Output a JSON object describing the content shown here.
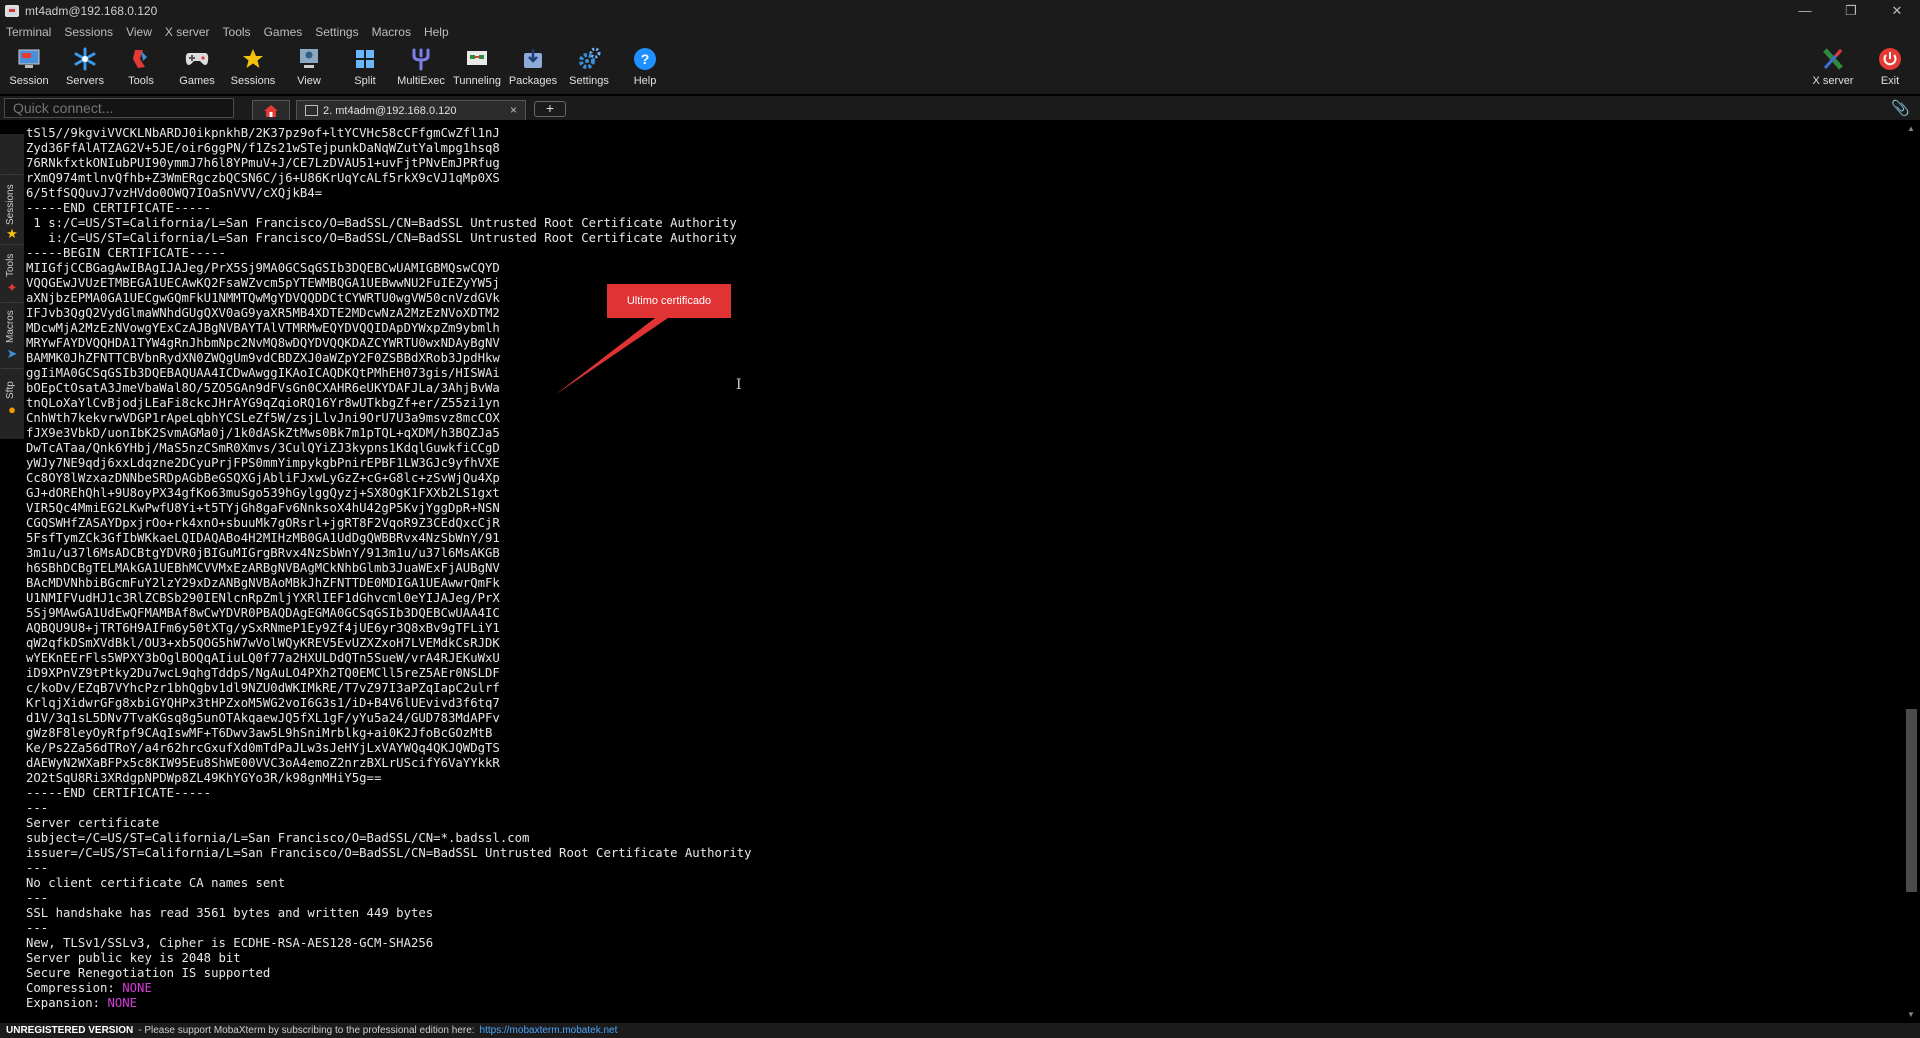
{
  "window": {
    "title": "mt4adm@192.168.0.120"
  },
  "menu": [
    "Terminal",
    "Sessions",
    "View",
    "X server",
    "Tools",
    "Games",
    "Settings",
    "Macros",
    "Help"
  ],
  "toolbar": {
    "session": "Session",
    "servers": "Servers",
    "tools": "Tools",
    "games": "Games",
    "sessions": "Sessions",
    "view": "View",
    "split": "Split",
    "multiexec": "MultiExec",
    "tunneling": "Tunneling",
    "packages": "Packages",
    "settings": "Settings",
    "help": "Help",
    "xserver": "X server",
    "exit": "Exit"
  },
  "tabs": {
    "quick_connect_placeholder": "Quick connect...",
    "session_tab_label": "2. mt4adm@192.168.0.120",
    "close": "×",
    "add": "+"
  },
  "sidebar": {
    "tabs": [
      "Sessions",
      "Tools",
      "Macros",
      "Sftp"
    ]
  },
  "terminal": {
    "lines": [
      "tSl5//9kgviVVCKLNbARDJ0ikpnkhB/2K37pz9of+ltYCVHc58cCFfgmCwZfl1nJ",
      "Zyd36FfAlATZAG2V+5JE/oir6ggPN/f1Zs21wSTejpunkDaNqWZutYalmpg1hsq8",
      "76RNkfxtkONIubPUI90ymmJ7h6l8YPmuV+J/CE7LzDVAU51+uvFjtPNvEmJPRfug",
      "rXmQ974mtlnvQfhb+Z3WmERgczbQCSN6C/j6+U86KrUqYcALf5rkX9cVJ1qMp0XS",
      "6/5tfSQQuvJ7vzHVdo0OWQ7IOaSnVVV/cXQjkB4=",
      "-----END CERTIFICATE-----",
      " 1 s:/C=US/ST=California/L=San Francisco/O=BadSSL/CN=BadSSL Untrusted Root Certificate Authority",
      "   i:/C=US/ST=California/L=San Francisco/O=BadSSL/CN=BadSSL Untrusted Root Certificate Authority",
      "-----BEGIN CERTIFICATE-----",
      "MIIGfjCCBGagAwIBAgIJAJeg/PrX5Sj9MA0GCSqGSIb3DQEBCwUAMIGBMQswCQYD",
      "VQQGEwJVUzETMBEGA1UECAwKQ2FsaWZvcm5pYTEWMBQGA1UEBwwNU2FuIEZyYW5j",
      "aXNjbzEPMA0GA1UECgwGQmFkU1NMMTQwMgYDVQQDDCtCYWRTU0wgVW50cnVzdGVk",
      "IFJvb3QgQ2VydGlmaWNhdGUgQXV0aG9yaXR5MB4XDTE2MDcwNzA2MzEzNVoXDTM2",
      "MDcwMjA2MzEzNVowgYExCzAJBgNVBAYTAlVTMRMwEQYDVQQIDApDYWxpZm9ybmlh",
      "MRYwFAYDVQQHDA1TYW4gRnJhbmNpc2NvMQ8wDQYDVQQKDAZCYWRTU0wxNDAyBgNV",
      "BAMMK0JhZFNTTCBVbnRydXN0ZWQgUm9vdCBDZXJ0aWZpY2F0ZSBBdXRob3JpdHkw",
      "ggIiMA0GCSqGSIb3DQEBAQUAA4ICDwAwggIKAoICAQDKQtPMhEH073gis/HISWAi",
      "bOEpCtOsatA3JmeVbaWal8O/5ZO5GAn9dFVsGn0CXAHR6eUKYDAFJLa/3AhjBvWa",
      "tnQLoXaYlCvBjodjLEaFi8ckcJHrAYG9qZqioRQ16Yr8wUTkbgZf+er/Z55zi1yn",
      "CnhWth7kekvrwVDGP1rApeLqbhYCSLeZf5W/zsjLlvJni9OrU7U3a9msvz8mcCOX",
      "fJX9e3VbkD/uonIbK2SvmAGMa0j/1k0dASkZtMws0Bk7m1pTQL+qXDM/h3BQZJa5",
      "DwTcATaa/Qnk6YHbj/MaS5nzCSmR0Xmvs/3CulQYiZJ3kypns1KdqlGuwkfiCCgD",
      "yWJy7NE9qdj6xxLdqzne2DCyuPrjFPS0mmYimpykgbPnirEPBF1LW3GJc9yfhVXE",
      "Cc8OY8lWzxazDNNbeSRDpAGbBeGSQXGjAbliFJxwLyGzZ+cG+G8lc+zSvWjQu4Xp",
      "GJ+dOREhQhl+9U8oyPX34gfKo63muSgo539hGylggQyzj+SX8OgK1FXXb2LS1gxt",
      "VIR5Qc4MmiEG2LKwPwfU8Yi+t5TYjGh8gaFv6NnksoX4hU42gP5KvjYggDpR+NSN",
      "CGQSWHfZASAYDpxjrOo+rk4xnO+sbuuMk7gORsrl+jgRT8F2VqoR9Z3CEdQxcCjR",
      "5FsfTymZCk3GfIbWKkaeLQIDAQABo4H2MIHzMB0GA1UdDgQWBBRvx4NzSbWnY/91",
      "3m1u/u37l6MsADCBtgYDVR0jBIGuMIGrgBRvx4NzSbWnY/913m1u/u37l6MsAKGB",
      "h6SBhDCBgTELMAkGA1UEBhMCVVMxEzARBgNVBAgMCkNhbGlmb3JuaWExFjAUBgNV",
      "BAcMDVNhbiBGcmFuY2lzY29xDzANBgNVBAoMBkJhZFNTTDE0MDIGA1UEAwwrQmFk",
      "U1NMIFVudHJ1c3RlZCBSb290IENlcnRpZmljYXRlIEF1dGhvcml0eYIJAJeg/PrX",
      "5Sj9MAwGA1UdEwQFMAMBAf8wCwYDVR0PBAQDAgEGMA0GCSqGSIb3DQEBCwUAA4IC",
      "AQBQU9U8+jTRT6H9AIFm6y50tXTg/ySxRNmeP1Ey9Zf4jUE6yr3Q8xBv9gTFLiY1",
      "qW2qfkDSmXVdBkl/OU3+xb5QOG5hW7wVolWQyKREV5EvUZXZxoH7LVEMdkCsRJDK",
      "wYEKnEErFls5WPXY3bOglBOQqAIiuLQ0f77a2HXULDdQTn5SueW/vrA4RJEKuWxU",
      "iD9XPnVZ9tPtky2Du7wcL9qhgTddpS/NgAuLO4PXh2TQ0EMCll5reZ5AEr0NSLDF",
      "c/koDv/EZqB7VYhcPzr1bhQgbv1dl9NZU0dWKIMkRE/T7vZ97I3aPZqIapC2ulrf",
      "KrlqjXidwrGFg8xbiGYQHPx3tHPZxoM5WG2voI6G3s1/iD+B4V6lUEvivd3f6tq7",
      "d1V/3q1sL5DNv7TvaKGsq8g5unOTAkqaewJQ5fXL1gF/yYu5a24/GUD783MdAPFv",
      "gWz8F8leyOyRfpf9CAqIswMF+T6Dwv3aw5L9hSniMrblkg+ai0K2JfoBcGOzMtB",
      "Ke/Ps2Za56dTRoY/a4r62hrcGxufXd0mTdPaJLw3sJeHYjLxVAYWQq4QKJQWDgTS",
      "dAEWyN2WXaBFPx5c8KIW95Eu8ShWE00VVC3oA4emoZ2nrzBXLrUScifY6VaYYkkR",
      "2O2tSqU8Ri3XRdgpNPDWp8ZL49KhYGYo3R/k98gnMHiY5g==",
      "-----END CERTIFICATE-----",
      "---",
      "Server certificate",
      "subject=/C=US/ST=California/L=San Francisco/O=BadSSL/CN=*.badssl.com",
      "issuer=/C=US/ST=California/L=San Francisco/O=BadSSL/CN=BadSSL Untrusted Root Certificate Authority",
      "---",
      "No client certificate CA names sent",
      "---",
      "SSL handshake has read 3561 bytes and written 449 bytes",
      "---",
      "New, TLSv1/SSLv3, Cipher is ECDHE-RSA-AES128-GCM-SHA256",
      "Server public key is 2048 bit",
      "Secure Renegotiation IS supported"
    ],
    "compression_label": "Compression: ",
    "compression_value": "NONE",
    "expansion_label": "Expansion: ",
    "expansion_value": "NONE"
  },
  "annotation": {
    "text": "Ultimo certificado",
    "color": "#e03333"
  },
  "statusbar": {
    "unregistered": "UNREGISTERED VERSION",
    "message": " -  Please support MobaXterm by subscribing to the professional edition here:",
    "link": "https://mobaxterm.mobatek.net"
  },
  "colors": {
    "background": "#000000",
    "chrome": "#1b1b1b",
    "accent_blue": "#3b8ed8",
    "keyword_magenta": "#d63cd6"
  }
}
